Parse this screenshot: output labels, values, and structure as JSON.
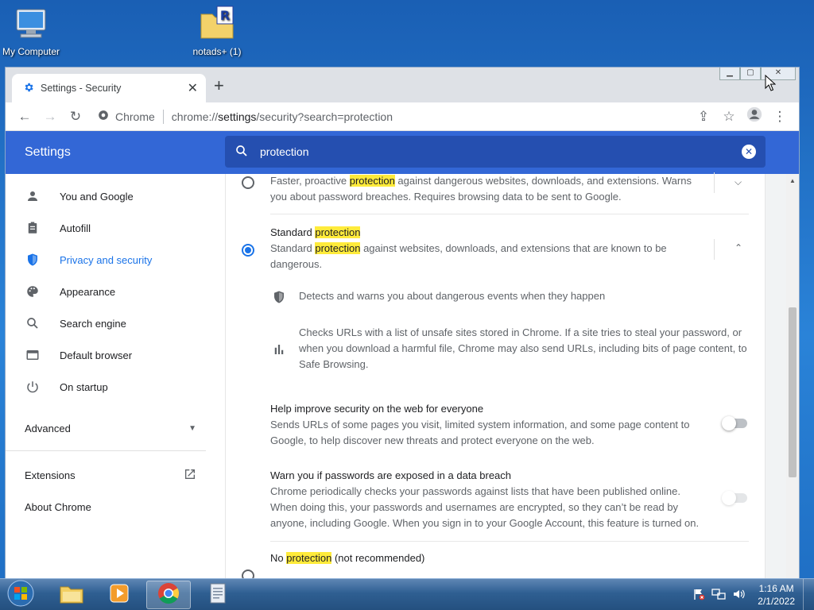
{
  "desktop": {
    "icons": [
      {
        "label": "My Computer",
        "icon": "computer-icon"
      },
      {
        "label": "notads+ (1)",
        "icon": "folder-icon"
      }
    ]
  },
  "browser": {
    "tab": {
      "title": "Settings - Security",
      "icon": "gear-icon"
    },
    "omnibox": {
      "site": "Chrome",
      "url_prefix": "chrome://",
      "url_host": "settings",
      "url_rest": "/security?search=protection"
    }
  },
  "settings": {
    "title": "Settings",
    "search": {
      "query": "protection"
    },
    "nav": [
      {
        "label": "You and Google",
        "icon": "person-icon"
      },
      {
        "label": "Autofill",
        "icon": "clipboard-icon"
      },
      {
        "label": "Privacy and security",
        "icon": "shield-icon",
        "active": true
      },
      {
        "label": "Appearance",
        "icon": "palette-icon"
      },
      {
        "label": "Search engine",
        "icon": "search-icon"
      },
      {
        "label": "Default browser",
        "icon": "browser-icon"
      },
      {
        "label": "On startup",
        "icon": "power-icon"
      }
    ],
    "advanced": "Advanced",
    "extensions": "Extensions",
    "about": "About Chrome",
    "enhanced": {
      "desc_pre": "Faster, proactive ",
      "desc_hl": "protection",
      "desc_post": " against dangerous websites, downloads, and extensions. Warns you about password breaches. Requires browsing data to be sent to Google."
    },
    "standard": {
      "title_pre": "Standard ",
      "title_hl": "protection",
      "desc_pre": "Standard ",
      "desc_hl": "protection",
      "desc_post": " against websites, downloads, and extensions that are known to be dangerous.",
      "detail1": "Detects and warns you about dangerous events when they happen",
      "detail2": "Checks URLs with a list of unsafe sites stored in Chrome. If a site tries to steal your password, or when you download a harmful file, Chrome may also send URLs, including bits of page content, to Safe Browsing."
    },
    "help_improve": {
      "title": "Help improve security on the web for everyone",
      "desc": "Sends URLs of some pages you visit, limited system information, and some page content to Google, to help discover new threats and protect everyone on the web."
    },
    "warn_passwords": {
      "title": "Warn you if passwords are exposed in a data breach",
      "desc": "Chrome periodically checks your passwords against lists that have been published online. When doing this, your passwords and usernames are encrypted, so they can’t be read by anyone, including Google. When you sign in to your Google Account, this feature is turned on."
    },
    "no_protection": {
      "title_pre": "No ",
      "title_hl": "protection",
      "title_post": " (not recommended)"
    }
  },
  "taskbar": {
    "apps": [
      "explorer-icon",
      "media-player-icon",
      "chrome-icon",
      "notepad-icon"
    ],
    "clock": {
      "time": "1:16 AM",
      "date": "2/1/2022"
    }
  }
}
